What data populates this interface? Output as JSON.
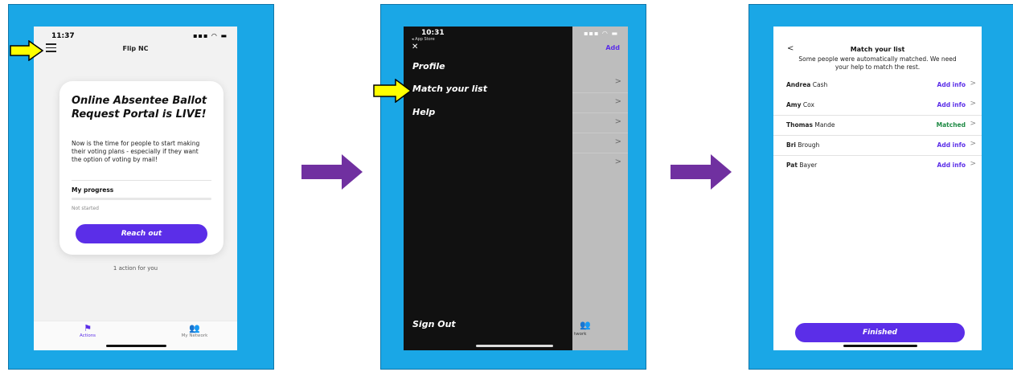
{
  "colors": {
    "panel_bg": "#1aa7e6",
    "accent": "#5b2ee8",
    "matched": "#1e8a44",
    "arrow_yellow": "#ffff00",
    "arrow_purple": "#7030a0"
  },
  "screen1": {
    "time": "11:37",
    "signal": "▪▪▪ ◠ ▬",
    "title": "Flip NC",
    "card_title": "Online Absentee Ballot Request Portal is LIVE!",
    "card_body": "Now is the time for people to start making their voting plans - especially if they want the option of voting by mail!",
    "progress_label": "My progress",
    "progress_status": "Not started",
    "progress_value": 0,
    "reach_out": "Reach out",
    "actions_count": "1 action for you",
    "tab_actions": "Actions",
    "tab_network": "My Network"
  },
  "screen2": {
    "time": "10:31",
    "back_app": "◂ App Store",
    "close": "✕",
    "add": "Add",
    "menu": [
      "Profile",
      "Match your list",
      "Help"
    ],
    "sign_out": "Sign Out",
    "network_tab": "twork"
  },
  "screen3": {
    "back": "<",
    "title": "Match your list",
    "subtitle": "Some people were automatically matched. We need your help to match the rest.",
    "rows": [
      {
        "first": "Andrea",
        "last": "Cash",
        "status": "Add info"
      },
      {
        "first": "Amy",
        "last": "Cox",
        "status": "Add info"
      },
      {
        "first": "Thomas",
        "last": "Mande",
        "status": "Matched"
      },
      {
        "first": "Bri",
        "last": "Brough",
        "status": "Add info"
      },
      {
        "first": "Pat",
        "last": "Bayer",
        "status": "Add info"
      }
    ],
    "finished": "Finished"
  }
}
